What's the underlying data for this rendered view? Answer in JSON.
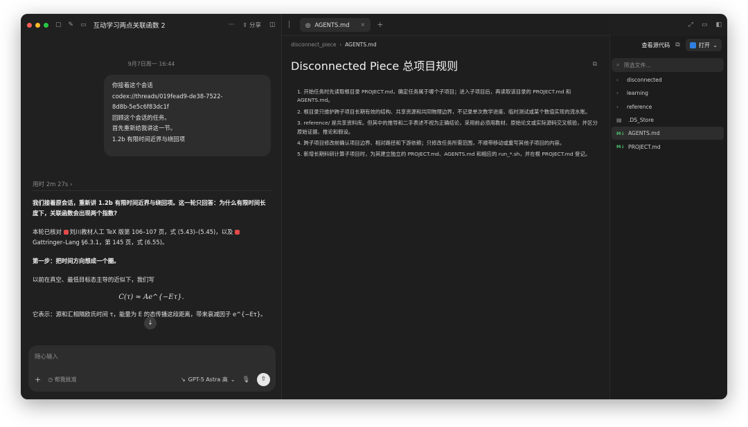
{
  "chat": {
    "window_title": "互动学习两点关联函数 2",
    "share_label": "分享",
    "date": "9月7日周一 16:44",
    "user_message_lines": [
      "你接着这个会话",
      "codex://threads/019fead9-de38-7522-",
      "8d8b-5e5c6f83dc1f",
      "回顾这个会话的任务。",
      "首先重新给我讲这一节。",
      "1.2b 有限时间近界与绕回项"
    ],
    "worked_label": "用时 2m 27s",
    "assistant": {
      "p1": "我们接着原会话，重新讲 1.2b 有限时间近界与绕回项。这一轮只回答：为什么有限时间长度下，关联函数会出现两个指数?",
      "p2_a": "本轮已核对",
      "p2_b": "刘川教材人工 TeX 版第 106–107 页，式 (5.43)–(5.45)，以及",
      "p2_c": "Gattringer–Lang §6.3.1，第 145 页，式 (6.55)。",
      "p3": "第一步：把时间方向想成一个圈。",
      "p4": "以前在真空、最低目标态主导的近似下，我们写",
      "formula": "C(τ) ≈ Ae^{−Eτ}.",
      "p5": "它表示：源和汇相隔欧氏时间 τ，能量为 E 的态传播这段距离，带来衰减因子 e^{−Eτ}。"
    },
    "composer": {
      "placeholder": "随心输入",
      "access_label": "帮我批准",
      "model_label": "GPT-5 Astra 高"
    }
  },
  "editor": {
    "tab_label": "AGENTS.md",
    "breadcrumb_parent": "disconnect_piece",
    "breadcrumb_current": "AGENTS.md",
    "doc_title": "Disconnected Piece 总项目规则",
    "rules": [
      "1. 开始任务时先读取根目录 PROJECT.md，确定任务属于哪个子项目；进入子项目后，再读取该目录的 PROJECT.md 和 AGENTS.md。",
      "2. 根目录只维护跨子项目长期有效的结构、共享资源和共同物理边界，不记录单次数学进度、临时测试或某个数值实现的流水账。",
      "3. reference/ 是共享资料库。但其中的推导和二手表述不视为正确结论，采用前必须用教材、原始论文或实际源码交叉核验，并区分原始证据、推论和假设。",
      "4. 跨子项目修改前确认项目边界、相对路径和下游依赖；只修改任务所需范围，不顺带移动或重写其他子项目的内容。",
      "5. 新增长期科研计算子项目时，为其建立独立的 PROJECT.md、AGENTS.md 和相应的 run_*.sh，并在根 PROJECT.md 登记。"
    ]
  },
  "files": {
    "view_source_label": "查看源代码",
    "open_label": "打开",
    "filter_placeholder": "筛选文件...",
    "items": [
      {
        "name": "disconnected",
        "kind": "folder"
      },
      {
        "name": "learning",
        "kind": "folder"
      },
      {
        "name": "reference",
        "kind": "folder"
      },
      {
        "name": ".DS_Store",
        "kind": "file"
      },
      {
        "name": "AGENTS.md",
        "kind": "md"
      },
      {
        "name": "PROJECT.md",
        "kind": "md"
      }
    ],
    "selected": "AGENTS.md"
  },
  "colors": {
    "traffic_red": "#ff5f57",
    "traffic_yellow": "#febc2e",
    "traffic_green": "#28c840",
    "md_badge": "#4fbf6f",
    "vscode_blue": "#2f7fe0"
  }
}
